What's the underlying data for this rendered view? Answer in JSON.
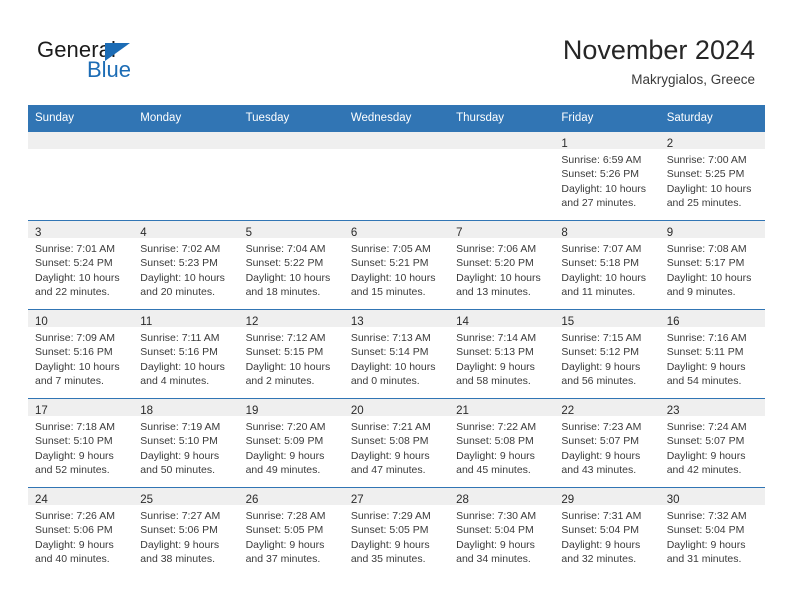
{
  "brand": {
    "name_part1": "General",
    "name_part2": "Blue",
    "triangle_color": "#1c6cb5"
  },
  "header": {
    "month_title": "November 2024",
    "location": "Makrygialos, Greece",
    "header_bg": "#3175b4",
    "daynum_band_bg": "#efefef"
  },
  "weekdays": [
    "Sunday",
    "Monday",
    "Tuesday",
    "Wednesday",
    "Thursday",
    "Friday",
    "Saturday"
  ],
  "weeks": [
    [
      {
        "empty": true
      },
      {
        "empty": true
      },
      {
        "empty": true
      },
      {
        "empty": true
      },
      {
        "empty": true
      },
      {
        "day": "1",
        "sunrise": "Sunrise: 6:59 AM",
        "sunset": "Sunset: 5:26 PM",
        "daylight1": "Daylight: 10 hours",
        "daylight2": "and 27 minutes."
      },
      {
        "day": "2",
        "sunrise": "Sunrise: 7:00 AM",
        "sunset": "Sunset: 5:25 PM",
        "daylight1": "Daylight: 10 hours",
        "daylight2": "and 25 minutes."
      }
    ],
    [
      {
        "day": "3",
        "sunrise": "Sunrise: 7:01 AM",
        "sunset": "Sunset: 5:24 PM",
        "daylight1": "Daylight: 10 hours",
        "daylight2": "and 22 minutes."
      },
      {
        "day": "4",
        "sunrise": "Sunrise: 7:02 AM",
        "sunset": "Sunset: 5:23 PM",
        "daylight1": "Daylight: 10 hours",
        "daylight2": "and 20 minutes."
      },
      {
        "day": "5",
        "sunrise": "Sunrise: 7:04 AM",
        "sunset": "Sunset: 5:22 PM",
        "daylight1": "Daylight: 10 hours",
        "daylight2": "and 18 minutes."
      },
      {
        "day": "6",
        "sunrise": "Sunrise: 7:05 AM",
        "sunset": "Sunset: 5:21 PM",
        "daylight1": "Daylight: 10 hours",
        "daylight2": "and 15 minutes."
      },
      {
        "day": "7",
        "sunrise": "Sunrise: 7:06 AM",
        "sunset": "Sunset: 5:20 PM",
        "daylight1": "Daylight: 10 hours",
        "daylight2": "and 13 minutes."
      },
      {
        "day": "8",
        "sunrise": "Sunrise: 7:07 AM",
        "sunset": "Sunset: 5:18 PM",
        "daylight1": "Daylight: 10 hours",
        "daylight2": "and 11 minutes."
      },
      {
        "day": "9",
        "sunrise": "Sunrise: 7:08 AM",
        "sunset": "Sunset: 5:17 PM",
        "daylight1": "Daylight: 10 hours",
        "daylight2": "and 9 minutes."
      }
    ],
    [
      {
        "day": "10",
        "sunrise": "Sunrise: 7:09 AM",
        "sunset": "Sunset: 5:16 PM",
        "daylight1": "Daylight: 10 hours",
        "daylight2": "and 7 minutes."
      },
      {
        "day": "11",
        "sunrise": "Sunrise: 7:11 AM",
        "sunset": "Sunset: 5:16 PM",
        "daylight1": "Daylight: 10 hours",
        "daylight2": "and 4 minutes."
      },
      {
        "day": "12",
        "sunrise": "Sunrise: 7:12 AM",
        "sunset": "Sunset: 5:15 PM",
        "daylight1": "Daylight: 10 hours",
        "daylight2": "and 2 minutes."
      },
      {
        "day": "13",
        "sunrise": "Sunrise: 7:13 AM",
        "sunset": "Sunset: 5:14 PM",
        "daylight1": "Daylight: 10 hours",
        "daylight2": "and 0 minutes."
      },
      {
        "day": "14",
        "sunrise": "Sunrise: 7:14 AM",
        "sunset": "Sunset: 5:13 PM",
        "daylight1": "Daylight: 9 hours",
        "daylight2": "and 58 minutes."
      },
      {
        "day": "15",
        "sunrise": "Sunrise: 7:15 AM",
        "sunset": "Sunset: 5:12 PM",
        "daylight1": "Daylight: 9 hours",
        "daylight2": "and 56 minutes."
      },
      {
        "day": "16",
        "sunrise": "Sunrise: 7:16 AM",
        "sunset": "Sunset: 5:11 PM",
        "daylight1": "Daylight: 9 hours",
        "daylight2": "and 54 minutes."
      }
    ],
    [
      {
        "day": "17",
        "sunrise": "Sunrise: 7:18 AM",
        "sunset": "Sunset: 5:10 PM",
        "daylight1": "Daylight: 9 hours",
        "daylight2": "and 52 minutes."
      },
      {
        "day": "18",
        "sunrise": "Sunrise: 7:19 AM",
        "sunset": "Sunset: 5:10 PM",
        "daylight1": "Daylight: 9 hours",
        "daylight2": "and 50 minutes."
      },
      {
        "day": "19",
        "sunrise": "Sunrise: 7:20 AM",
        "sunset": "Sunset: 5:09 PM",
        "daylight1": "Daylight: 9 hours",
        "daylight2": "and 49 minutes."
      },
      {
        "day": "20",
        "sunrise": "Sunrise: 7:21 AM",
        "sunset": "Sunset: 5:08 PM",
        "daylight1": "Daylight: 9 hours",
        "daylight2": "and 47 minutes."
      },
      {
        "day": "21",
        "sunrise": "Sunrise: 7:22 AM",
        "sunset": "Sunset: 5:08 PM",
        "daylight1": "Daylight: 9 hours",
        "daylight2": "and 45 minutes."
      },
      {
        "day": "22",
        "sunrise": "Sunrise: 7:23 AM",
        "sunset": "Sunset: 5:07 PM",
        "daylight1": "Daylight: 9 hours",
        "daylight2": "and 43 minutes."
      },
      {
        "day": "23",
        "sunrise": "Sunrise: 7:24 AM",
        "sunset": "Sunset: 5:07 PM",
        "daylight1": "Daylight: 9 hours",
        "daylight2": "and 42 minutes."
      }
    ],
    [
      {
        "day": "24",
        "sunrise": "Sunrise: 7:26 AM",
        "sunset": "Sunset: 5:06 PM",
        "daylight1": "Daylight: 9 hours",
        "daylight2": "and 40 minutes."
      },
      {
        "day": "25",
        "sunrise": "Sunrise: 7:27 AM",
        "sunset": "Sunset: 5:06 PM",
        "daylight1": "Daylight: 9 hours",
        "daylight2": "and 38 minutes."
      },
      {
        "day": "26",
        "sunrise": "Sunrise: 7:28 AM",
        "sunset": "Sunset: 5:05 PM",
        "daylight1": "Daylight: 9 hours",
        "daylight2": "and 37 minutes."
      },
      {
        "day": "27",
        "sunrise": "Sunrise: 7:29 AM",
        "sunset": "Sunset: 5:05 PM",
        "daylight1": "Daylight: 9 hours",
        "daylight2": "and 35 minutes."
      },
      {
        "day": "28",
        "sunrise": "Sunrise: 7:30 AM",
        "sunset": "Sunset: 5:04 PM",
        "daylight1": "Daylight: 9 hours",
        "daylight2": "and 34 minutes."
      },
      {
        "day": "29",
        "sunrise": "Sunrise: 7:31 AM",
        "sunset": "Sunset: 5:04 PM",
        "daylight1": "Daylight: 9 hours",
        "daylight2": "and 32 minutes."
      },
      {
        "day": "30",
        "sunrise": "Sunrise: 7:32 AM",
        "sunset": "Sunset: 5:04 PM",
        "daylight1": "Daylight: 9 hours",
        "daylight2": "and 31 minutes."
      }
    ]
  ]
}
